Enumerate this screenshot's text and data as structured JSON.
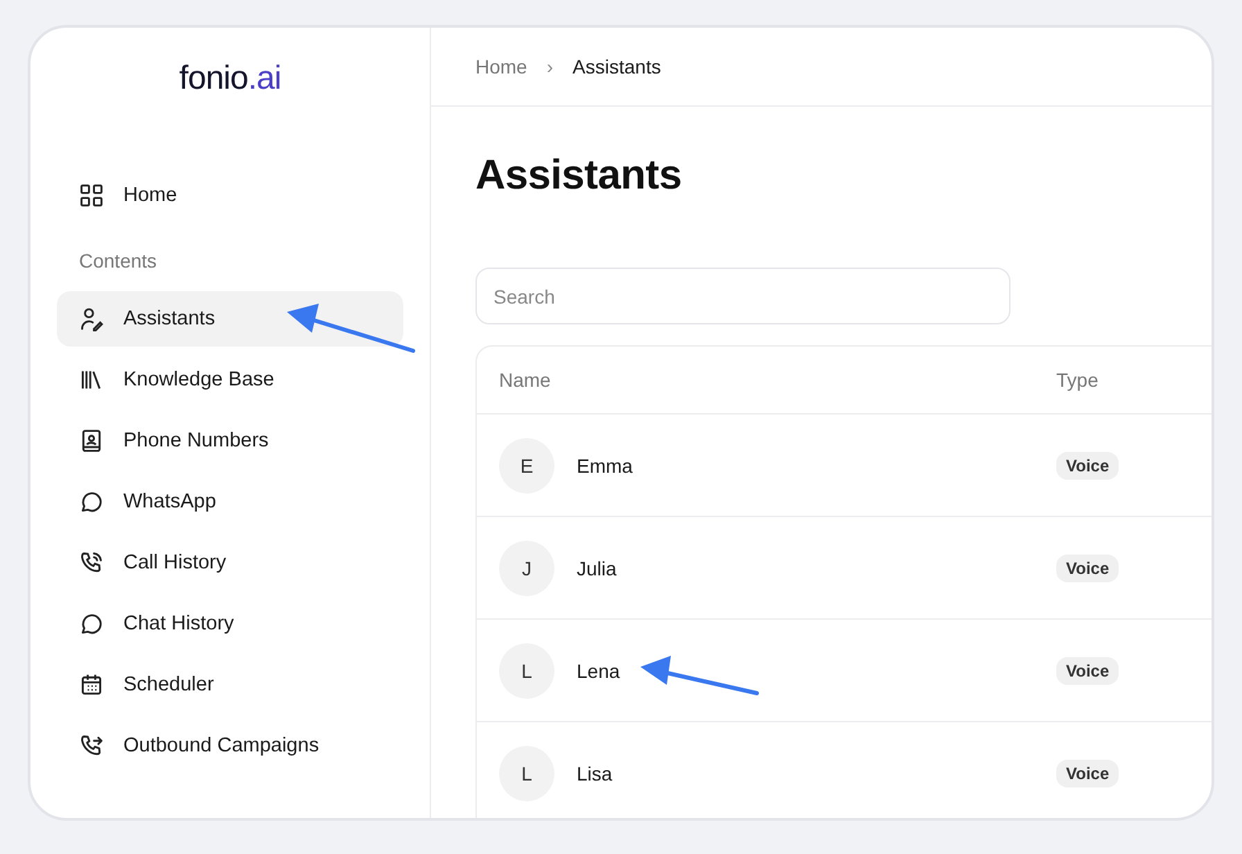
{
  "logo": {
    "wordmark": "fonio",
    "suffix": ".ai"
  },
  "sidebar": {
    "home": {
      "label": "Home",
      "selected": false
    },
    "section_label": "Contents",
    "items": [
      {
        "label": "Assistants",
        "selected": true
      },
      {
        "label": "Knowledge Base",
        "selected": false
      },
      {
        "label": "Phone Numbers",
        "selected": false
      },
      {
        "label": "WhatsApp",
        "selected": false
      },
      {
        "label": "Call History",
        "selected": false
      },
      {
        "label": "Chat History",
        "selected": false
      },
      {
        "label": "Scheduler",
        "selected": false
      },
      {
        "label": "Outbound Campaigns",
        "selected": false
      }
    ]
  },
  "breadcrumb": [
    "Home",
    "Assistants"
  ],
  "breadcrumb_separator": "›",
  "page_title": "Assistants",
  "search": {
    "placeholder": "Search"
  },
  "table": {
    "columns": [
      "Name",
      "Type"
    ],
    "rows": [
      {
        "initial": "E",
        "name": "Emma",
        "type": "Voice"
      },
      {
        "initial": "J",
        "name": "Julia",
        "type": "Voice"
      },
      {
        "initial": "L",
        "name": "Lena",
        "type": "Voice"
      },
      {
        "initial": "L",
        "name": "Lisa",
        "type": "Voice"
      }
    ]
  }
}
